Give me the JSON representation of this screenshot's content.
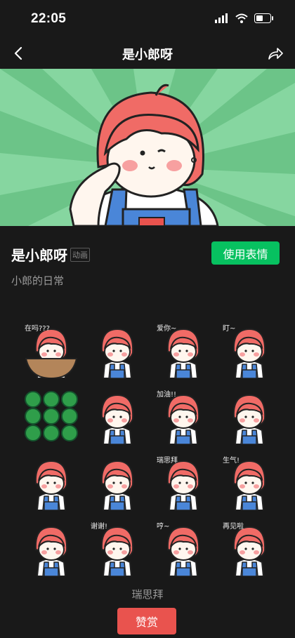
{
  "status_bar": {
    "time": "22:05"
  },
  "nav": {
    "title": "是小郎呀"
  },
  "pack": {
    "name": "是小郎呀",
    "type_tag": "动画",
    "use_button": "使用表情",
    "description": "小郎的日常"
  },
  "stickers": [
    {
      "caption": "在吗???"
    },
    {
      "caption": ""
    },
    {
      "caption": "爱你~"
    },
    {
      "caption": "盯~"
    },
    {
      "caption": ""
    },
    {
      "caption": ""
    },
    {
      "caption": "加油!!"
    },
    {
      "caption": ""
    },
    {
      "caption": ""
    },
    {
      "caption": ""
    },
    {
      "caption": "瑞思拜"
    },
    {
      "caption": "生气!"
    },
    {
      "caption": ""
    },
    {
      "caption": "谢谢!"
    },
    {
      "caption": "哼~"
    },
    {
      "caption": "再见啦"
    }
  ],
  "author": "瑞思拜",
  "reward_button": "赞赏",
  "colors": {
    "background": "#191919",
    "accent_green": "#07c160",
    "reward_red": "#e9534e",
    "hair": "#f06b66",
    "overalls": "#4a86d8"
  }
}
